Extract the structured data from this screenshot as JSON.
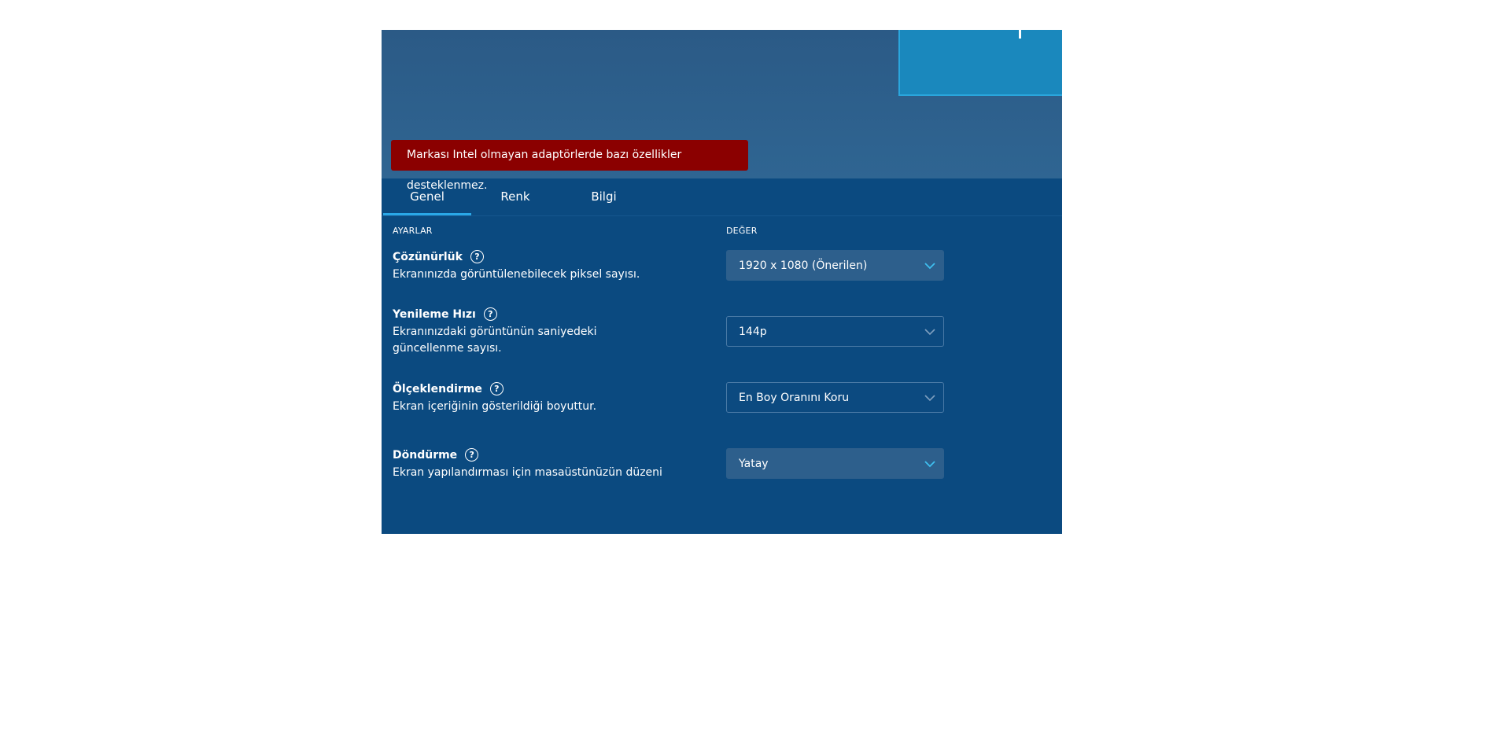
{
  "warning": {
    "text": "Markası Intel olmayan adaptörlerde bazı özellikler desteklenmez."
  },
  "tabs": [
    {
      "label": "Genel"
    },
    {
      "label": "Renk"
    },
    {
      "label": "Bilgi"
    }
  ],
  "columns": {
    "settings": "AYARLAR",
    "value": "DEĞER"
  },
  "settings": [
    {
      "title": "Çözünürlük",
      "description": "Ekranınızda görüntülenebilecek piksel sayısı.",
      "value": "1920 x 1080 (Önerilen)"
    },
    {
      "title": "Yenileme Hızı",
      "description": "Ekranınızdaki görüntünün saniyedeki güncellenme sayısı.",
      "value": "144p"
    },
    {
      "title": "Ölçeklendirme",
      "description": "Ekran içeriğinin gösterildiği boyuttur.",
      "value": "En Boy Oranını Koru"
    },
    {
      "title": "Döndürme",
      "description": "Ekran yapılandırması için masaüstünüzün düzeni",
      "value": "Yatay"
    }
  ],
  "colors": {
    "accent": "#2aa8e8",
    "warning": "#8b0000",
    "panel": "#0b4a80"
  },
  "icons": {
    "help": "help-circle-icon",
    "dropdown": "chevron-down-icon"
  }
}
